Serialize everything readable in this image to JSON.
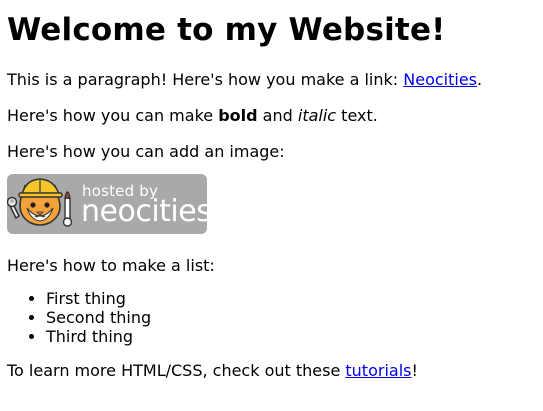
{
  "heading": "Welcome to my Website!",
  "paragraph1": {
    "before": "This is a paragraph! Here's how you make a link: ",
    "link_text": "Neocities",
    "after": "."
  },
  "paragraph2": {
    "before": "Here's how you can make ",
    "bold": "bold",
    "middle": " and ",
    "italic": "italic",
    "after": " text."
  },
  "paragraph3": "Here's how you can add an image:",
  "badge": {
    "small_text": "hosted by",
    "big_text": "neocities",
    "icon": "neocities-cat-mascot-icon",
    "background_color": "#a9a9a9"
  },
  "paragraph4": "Here's how to make a list:",
  "list_items": [
    "First thing",
    "Second thing",
    "Third thing"
  ],
  "paragraph5": {
    "before": "To learn more HTML/CSS, check out these ",
    "link_text": "tutorials",
    "after": "!"
  },
  "colors": {
    "link": "#0000ee",
    "text": "#000000",
    "background": "#ffffff"
  }
}
